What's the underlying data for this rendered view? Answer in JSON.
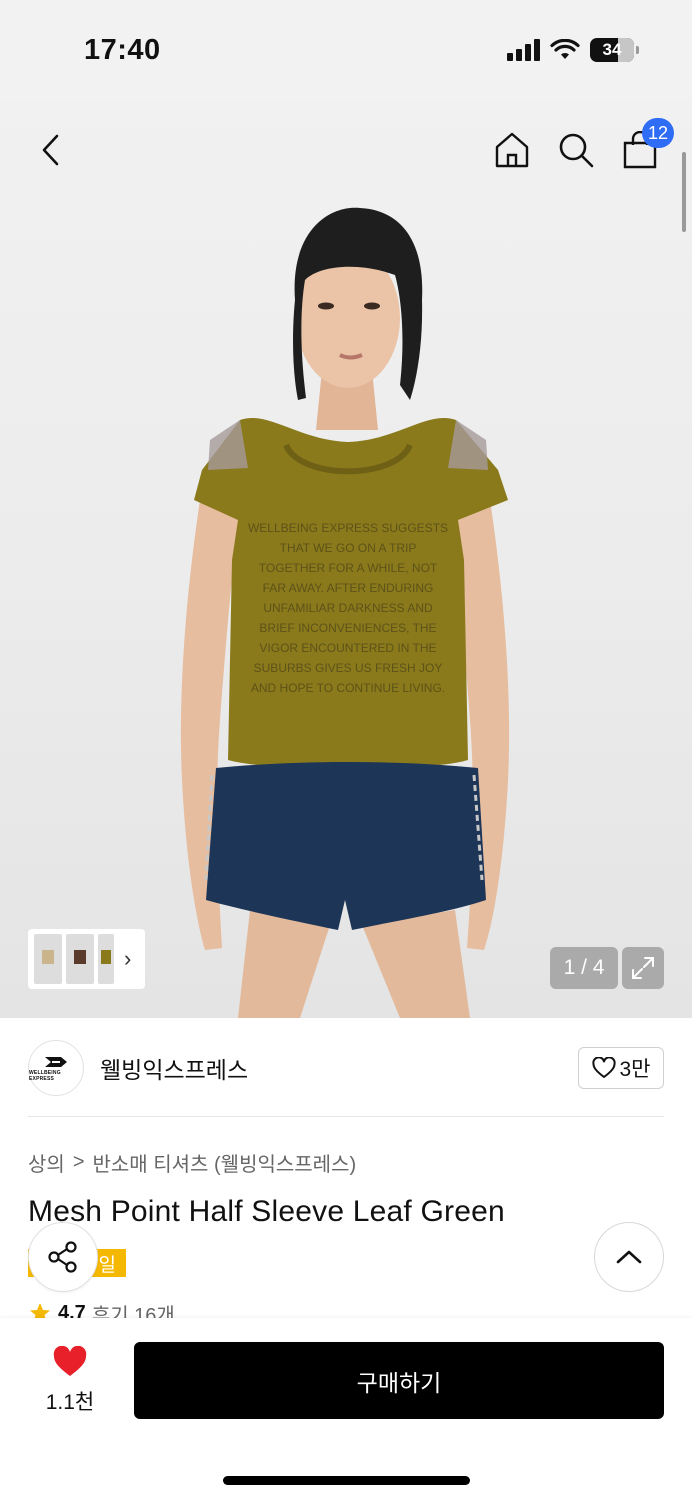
{
  "status_bar": {
    "time": "17:40",
    "battery": "34"
  },
  "header": {
    "back_icon": "chevron-left-icon",
    "home_icon": "home-icon",
    "search_icon": "search-icon",
    "cart_icon": "shopping-bag-icon",
    "cart_count": "12"
  },
  "gallery": {
    "pager": "1 / 4",
    "expand_icon": "expand-icon",
    "thumb_chevron": "›",
    "shirt_text": [
      "WELLBEING EXPRESS SUGGESTS",
      "THAT WE GO ON A TRIP",
      "TOGETHER FOR A WHILE, NOT",
      "FAR AWAY. AFTER ENDURING",
      "UNFAMILIAR DARKNESS AND",
      "BRIEF INCONVENIENCES, THE",
      "VIGOR ENCOUNTERED IN THE",
      "SUBURBS GIVES US FRESH JOY",
      "AND HOPE TO CONTINUE LIVING."
    ],
    "logo_text": "WELLBEING EXPRESS"
  },
  "brand": {
    "name": "웰빙익스프레스",
    "likes": "3만",
    "logo_text": "WELLBEING EXPRESS"
  },
  "breadcrumb": {
    "category": "상의",
    "separator": ">",
    "subcategory": "반소매 티셔츠 (웰빙익스프레스)"
  },
  "product": {
    "title": "Mesh Point Half Sleeve Leaf Green",
    "sale_badge": "일",
    "rating": "4.7",
    "reviews": "후기 16개"
  },
  "bottom_bar": {
    "wish_count": "1.1천",
    "buy_label": "구매하기"
  },
  "colors": {
    "accent_blue": "#2f6df6",
    "sale_yellow": "#f5b800",
    "heart_red": "#e8202a",
    "shirt_olive": "#8a7a1c",
    "shorts_navy": "#1d3557"
  }
}
